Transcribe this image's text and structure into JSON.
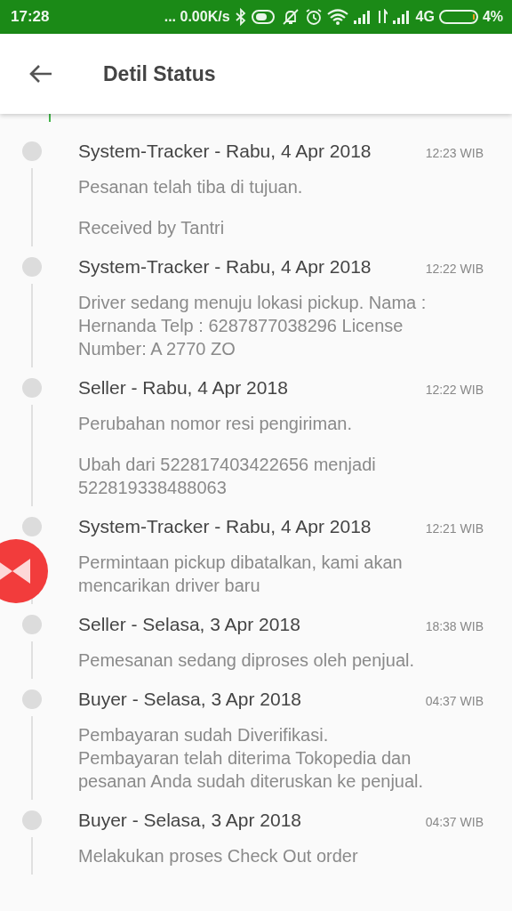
{
  "status_bar": {
    "time": "17:28",
    "network_speed": "... 0.00K/s",
    "network_type": "4G",
    "battery": "4%"
  },
  "app_bar": {
    "title": "Detil Status"
  },
  "timeline": [
    {
      "title": "System-Tracker - Rabu, 4 Apr 2018",
      "time": "12:23 WIB",
      "paragraphs": [
        [
          "Pesanan telah tiba di tujuan."
        ],
        [
          "Received by Tantri"
        ]
      ]
    },
    {
      "title": "System-Tracker - Rabu, 4 Apr 2018",
      "time": "12:22 WIB",
      "paragraphs": [
        [
          "Driver sedang menuju lokasi pickup. Nama :",
          "Hernanda Telp : 6287877038296 License",
          "Number: A 2770 ZO"
        ]
      ]
    },
    {
      "title": "Seller - Rabu, 4 Apr 2018",
      "time": "12:22 WIB",
      "paragraphs": [
        [
          "Perubahan nomor resi pengiriman."
        ],
        [
          "Ubah dari 522817403422656 menjadi",
          "522819338488063"
        ]
      ]
    },
    {
      "title": "System-Tracker - Rabu, 4 Apr 2018",
      "time": "12:21 WIB",
      "paragraphs": [
        [
          "Permintaan pickup dibatalkan, kami akan",
          "mencarikan driver baru"
        ]
      ]
    },
    {
      "title": "Seller - Selasa, 3 Apr 2018",
      "time": "18:38 WIB",
      "paragraphs": [
        [
          "Pemesanan sedang diproses oleh penjual."
        ]
      ]
    },
    {
      "title": "Buyer - Selasa, 3 Apr 2018",
      "time": "04:37 WIB",
      "paragraphs": [
        [
          "Pembayaran sudah Diverifikasi.",
          "Pembayaran telah diterima Tokopedia dan",
          "pesanan Anda sudah diteruskan ke penjual."
        ]
      ]
    },
    {
      "title": "Buyer - Selasa, 3 Apr 2018",
      "time": "04:37 WIB",
      "paragraphs": [
        [
          "Melakukan proses Check Out order"
        ]
      ]
    }
  ]
}
